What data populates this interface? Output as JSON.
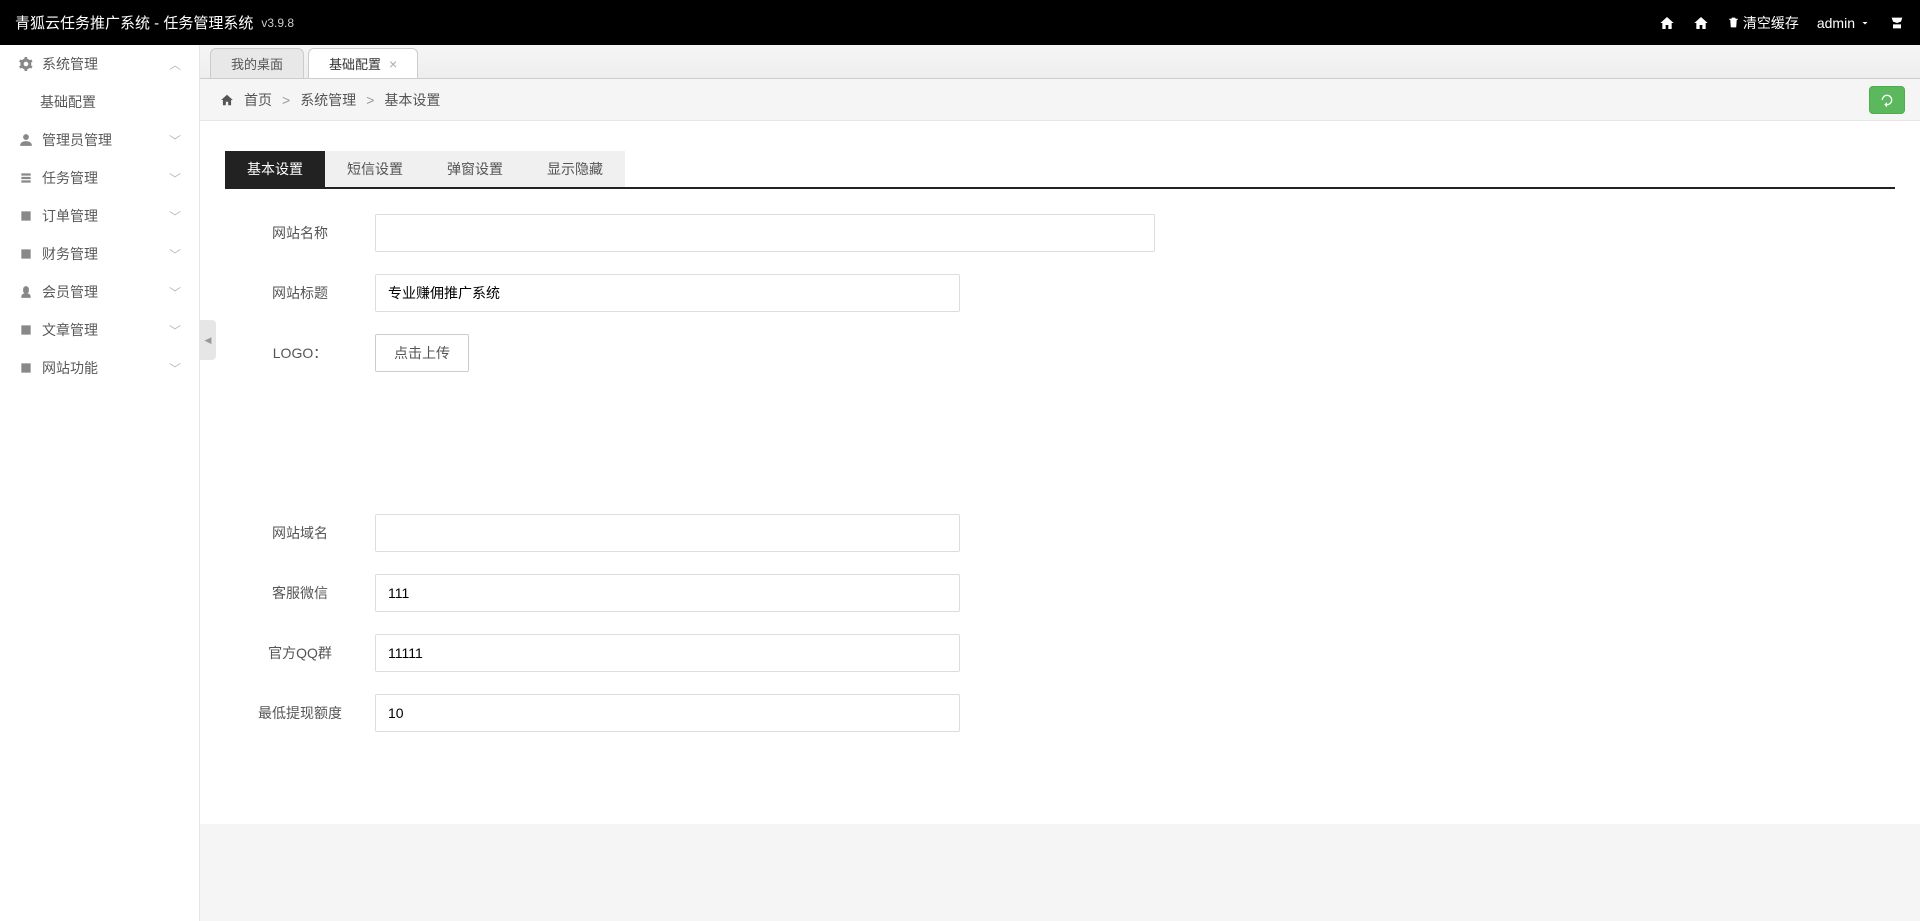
{
  "header": {
    "title": "青狐云任务推广系统 - 任务管理系统",
    "version": "v3.9.8",
    "clear_cache": "清空缓存",
    "user": "admin"
  },
  "sidebar": {
    "items": [
      {
        "label": "系统管理",
        "icon": "gear",
        "expanded": true,
        "sub": [
          {
            "label": "基础配置"
          }
        ]
      },
      {
        "label": "管理员管理",
        "icon": "user"
      },
      {
        "label": "任务管理",
        "icon": "task"
      },
      {
        "label": "订单管理",
        "icon": "calendar"
      },
      {
        "label": "财务管理",
        "icon": "money"
      },
      {
        "label": "会员管理",
        "icon": "member"
      },
      {
        "label": "文章管理",
        "icon": "article"
      },
      {
        "label": "网站功能",
        "icon": "site"
      }
    ]
  },
  "tabs": [
    {
      "label": "我的桌面",
      "closable": false
    },
    {
      "label": "基础配置",
      "closable": true,
      "active": true
    }
  ],
  "breadcrumb": {
    "home": "首页",
    "level1": "系统管理",
    "level2": "基本设置"
  },
  "sub_tabs": [
    {
      "label": "基本设置",
      "active": true
    },
    {
      "label": "短信设置"
    },
    {
      "label": "弹窗设置"
    },
    {
      "label": "显示隐藏"
    }
  ],
  "form": {
    "site_name": {
      "label": "网站名称",
      "value": ""
    },
    "site_title": {
      "label": "网站标题",
      "value": "专业赚佣推广系统"
    },
    "logo": {
      "label": "LOGO：",
      "button": "点击上传"
    },
    "site_domain": {
      "label": "网站域名",
      "value": ""
    },
    "wechat": {
      "label": "客服微信",
      "value": "111"
    },
    "qq_group": {
      "label": "官方QQ群",
      "value": "11111"
    },
    "min_withdraw": {
      "label": "最低提现额度",
      "value": "10"
    }
  }
}
